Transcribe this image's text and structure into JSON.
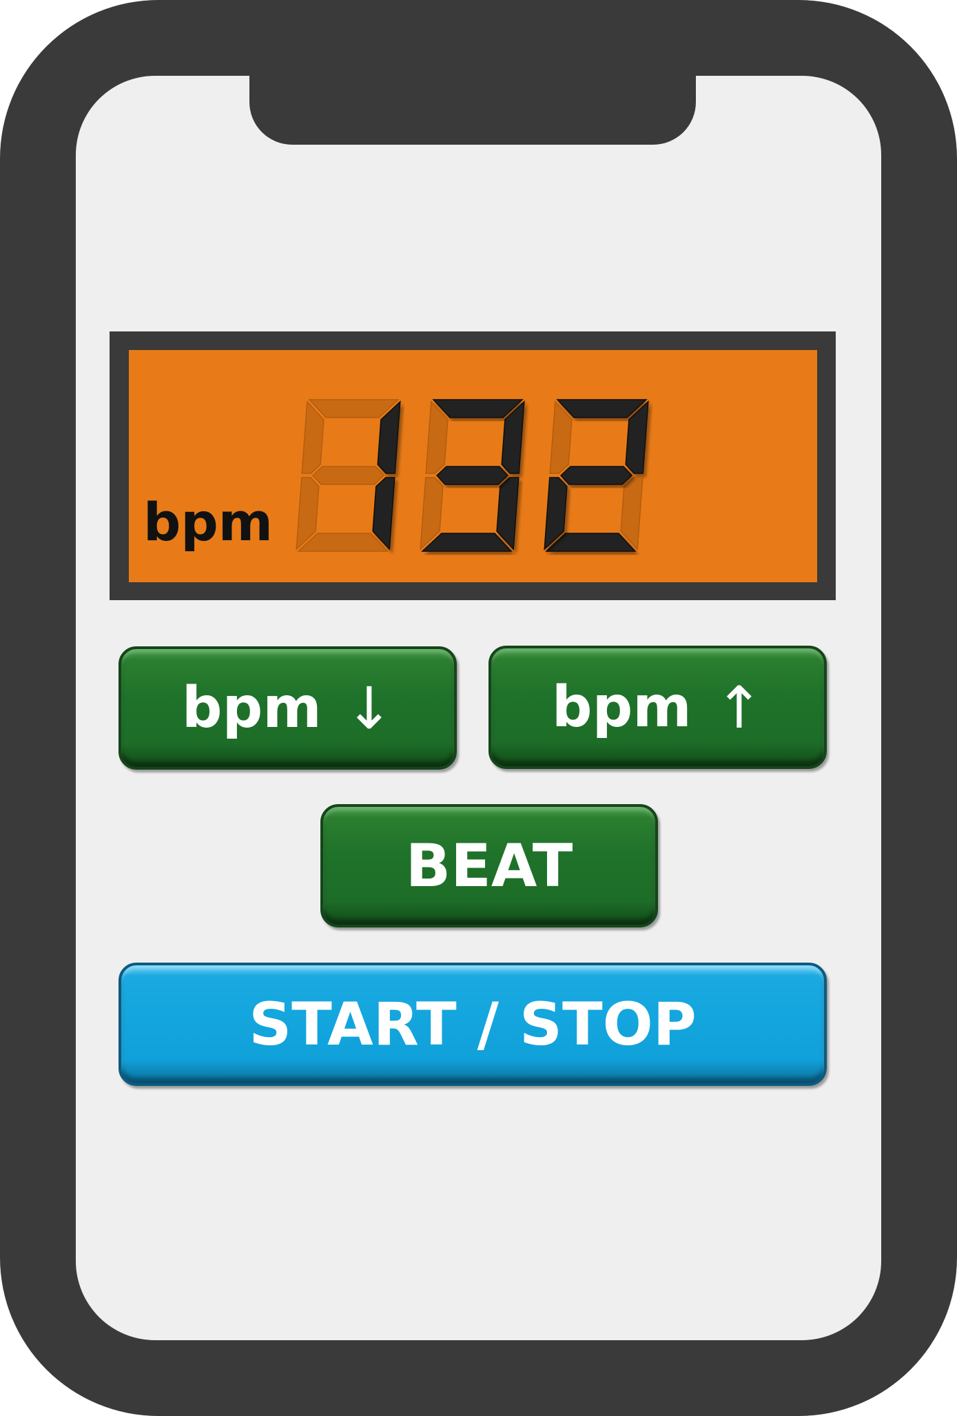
{
  "display": {
    "bpm_value": "132",
    "unit_label": "bpm",
    "lit_color": "#202020",
    "unlit_color": "#c86a14",
    "background_color": "#e87b18"
  },
  "buttons": {
    "bpm_down": {
      "label": "bpm",
      "arrow": "↓",
      "color": "#1f722a"
    },
    "bpm_up": {
      "label": "bpm",
      "arrow": "↑",
      "color": "#1f722a"
    },
    "beat": {
      "label": "BEAT",
      "color": "#1f722a"
    },
    "start_stop": {
      "label": "START / STOP",
      "color": "#14a6de"
    }
  }
}
